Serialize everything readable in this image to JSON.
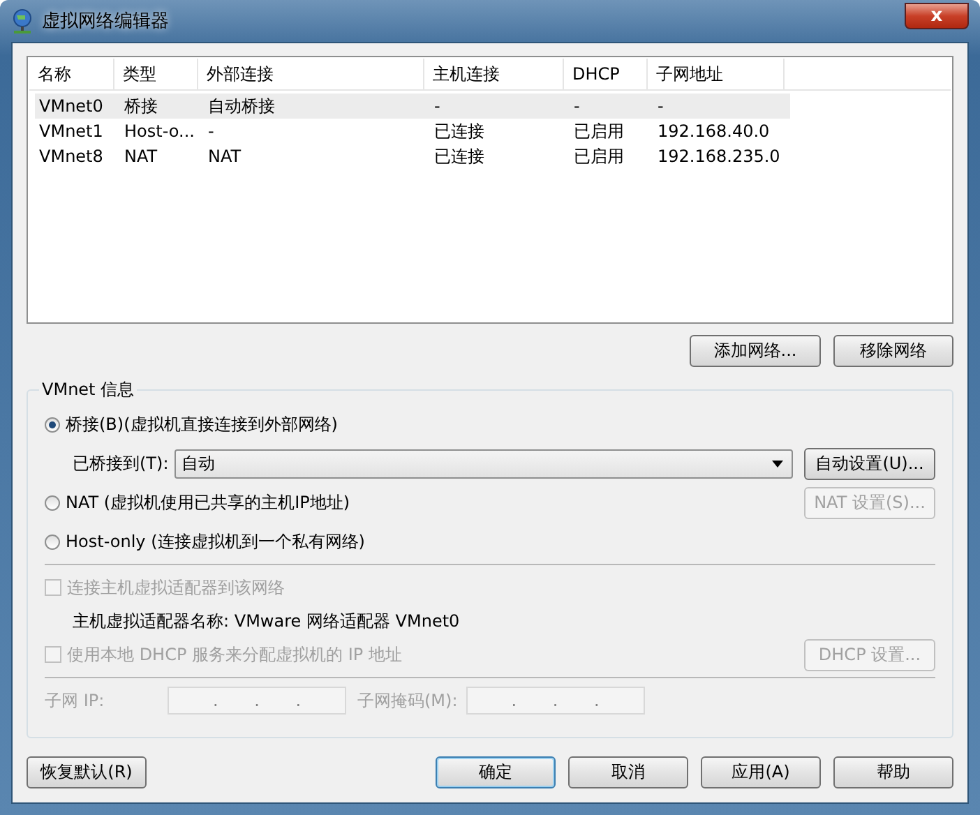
{
  "window": {
    "title": "虚拟网络编辑器",
    "close": "x"
  },
  "table": {
    "columns": [
      "名称",
      "类型",
      "外部连接",
      "主机连接",
      "DHCP",
      "子网地址"
    ],
    "rows": [
      {
        "cells": [
          "VMnet0",
          "桥接",
          "自动桥接",
          "-",
          "-",
          "-"
        ],
        "selected": true
      },
      {
        "cells": [
          "VMnet1",
          "Host-o...",
          "-",
          "已连接",
          "已启用",
          "192.168.40.0"
        ],
        "selected": false
      },
      {
        "cells": [
          "VMnet8",
          "NAT",
          "NAT",
          "已连接",
          "已启用",
          "192.168.235.0"
        ],
        "selected": false
      }
    ]
  },
  "table_buttons": [
    {
      "label": "添加网络...",
      "disabled": false
    },
    {
      "label": "移除网络",
      "disabled": false
    }
  ],
  "group": {
    "title": "VMnet 信息",
    "radios": [
      {
        "label": "桥接(B)(虚拟机直接连接到外部网络)",
        "selected": true
      },
      {
        "label": "NAT (虚拟机使用已共享的主机IP地址)",
        "selected": false,
        "button": {
          "label": "NAT 设置(S)...",
          "disabled": true
        }
      },
      {
        "label": "Host-only (连接虚拟机到一个私有网络)",
        "selected": false
      }
    ],
    "bridge": {
      "label": "已桥接到(T):",
      "value": "自动",
      "button": {
        "label": "自动设置(U)...",
        "disabled": false
      }
    },
    "connect_adapter": {
      "label": "连接主机虚拟适配器到该网络",
      "checked": false,
      "disabled": true
    },
    "adapter_name": "主机虚拟适配器名称: VMware 网络适配器 VMnet0",
    "dhcp": {
      "label": "使用本地 DHCP 服务来分配虚拟机的 IP 地址",
      "checked": false,
      "disabled": true,
      "button": {
        "label": "DHCP 设置...",
        "disabled": true
      }
    },
    "subnet_ip": {
      "label": "子网 IP:",
      "value": ". . ."
    },
    "subnet_mask": {
      "label": "子网掩码(M):",
      "value": ". . ."
    }
  },
  "footer_left": {
    "label": "恢复默认(R)",
    "disabled": false
  },
  "footer_buttons": [
    {
      "label": "确定",
      "default": true,
      "disabled": false
    },
    {
      "label": "取消",
      "default": false,
      "disabled": false
    },
    {
      "label": "应用(A)",
      "default": false,
      "disabled": false
    },
    {
      "label": "帮助",
      "default": false,
      "disabled": false
    }
  ]
}
